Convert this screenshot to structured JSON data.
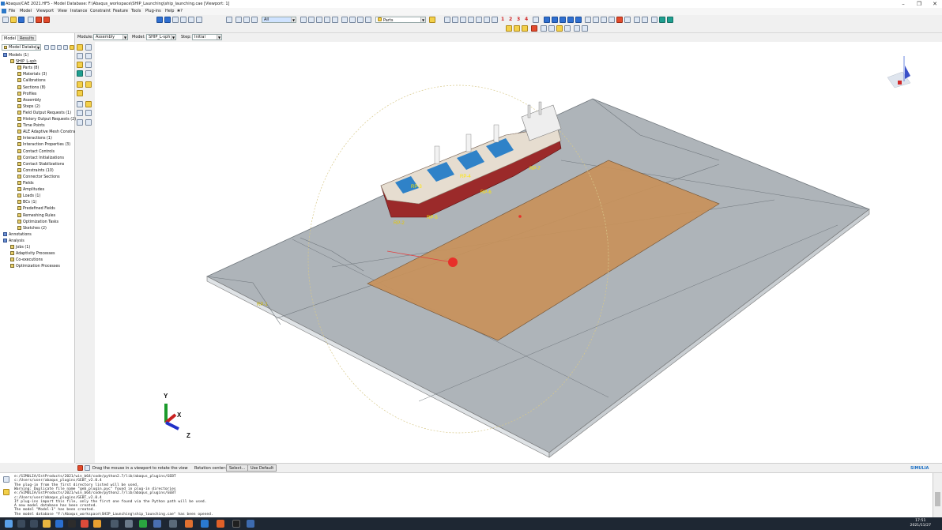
{
  "window": {
    "title": "Abaqus/CAE 2021.HF5 - Model Database: F:\\Abaqus_workspace\\SHIP_Launching\\ship_launching.cae [Viewport: 1]"
  },
  "menu": [
    "File",
    "Model",
    "Viewport",
    "View",
    "Instance",
    "Constraint",
    "Feature",
    "Tools",
    "Plug-ins",
    "Help",
    "❀?"
  ],
  "toolbar": {
    "filter_value": "All",
    "render_value": "Parts",
    "numbers": [
      "1",
      "2",
      "3",
      "4"
    ]
  },
  "left_panel": {
    "tabs": [
      "Model",
      "Results"
    ],
    "selector": "Model Database",
    "tree": [
      {
        "label": "Models (1)",
        "level": 0
      },
      {
        "label": "SHIP_L-sph",
        "level": 1
      },
      {
        "label": "Parts (8)",
        "level": 2
      },
      {
        "label": "Materials (3)",
        "level": 2
      },
      {
        "label": "Calibrations",
        "level": 2
      },
      {
        "label": "Sections (8)",
        "level": 2
      },
      {
        "label": "Profiles",
        "level": 2
      },
      {
        "label": "Assembly",
        "level": 2
      },
      {
        "label": "Steps (2)",
        "level": 2
      },
      {
        "label": "Field Output Requests (1)",
        "level": 2
      },
      {
        "label": "History Output Requests (2)",
        "level": 2
      },
      {
        "label": "Time Points",
        "level": 2
      },
      {
        "label": "ALE Adaptive Mesh Constra",
        "level": 2
      },
      {
        "label": "Interactions (1)",
        "level": 2
      },
      {
        "label": "Interaction Properties (3)",
        "level": 2
      },
      {
        "label": "Contact Controls",
        "level": 2
      },
      {
        "label": "Contact Initializations",
        "level": 2
      },
      {
        "label": "Contact Stabilizations",
        "level": 2
      },
      {
        "label": "Constraints (10)",
        "level": 2
      },
      {
        "label": "Connector Sections",
        "level": 2
      },
      {
        "label": "Fields",
        "level": 2
      },
      {
        "label": "Amplitudes",
        "level": 2
      },
      {
        "label": "Loads (1)",
        "level": 2
      },
      {
        "label": "BCs (1)",
        "level": 2
      },
      {
        "label": "Predefined Fields",
        "level": 2
      },
      {
        "label": "Remeshing Rules",
        "level": 2
      },
      {
        "label": "Optimization Tasks",
        "level": 2
      },
      {
        "label": "Sketches (2)",
        "level": 2
      },
      {
        "label": "Annotations",
        "level": 0
      },
      {
        "label": "Analysis",
        "level": 0
      },
      {
        "label": "Jobs (1)",
        "level": 1
      },
      {
        "label": "Adaptivity Processes",
        "level": 1
      },
      {
        "label": "Co-executions",
        "level": 1
      },
      {
        "label": "Optimization Processes",
        "level": 1
      }
    ]
  },
  "module_bar": {
    "module_label": "Module:",
    "module_value": "Assembly",
    "model_label": "Model:",
    "model_value": "SHIP_L-sph",
    "step_label": "Step:",
    "step_value": "Initial"
  },
  "viewport": {
    "ref_points": [
      "RP-1",
      "RP-2",
      "RP-3",
      "RP-4",
      "RP-5",
      "RP-6",
      "RP-7"
    ],
    "triad": {
      "x": "X",
      "y": "Y",
      "z": "Z"
    },
    "brand": "SIMULIA"
  },
  "statusbar": {
    "hint": "Drag the mouse in a viewport to rotate the view",
    "rotation_label": "Rotation center:",
    "select_btn": "Select...",
    "default_btn": "Use Default"
  },
  "messages": [
    "   e:/SIMULIA/EstProducts/2021/win_b64/code/python2.7/lib/abaqus_plugins/GEBT",
    "   c:/Users/user/abaqus_plugins/GEBT_v2.0.4",
    "   The plug-in from the first directory listed will be used.",
    "Warning: Duplicate file name \"geb_plugin.pyc\" found in plug-in directories",
    "   e:/SIMULIA/EstProducts/2021/win_b64/code/python2.7/lib/abaqus_plugins/GEBT",
    "   c:/Users/user/abaqus_plugins/GEBT_v2.0.4",
    "   If plug-ins import this file, only the first one found via the Python path will be used.",
    "A new model database has been created.",
    "The model \"Model-1\" has been created.",
    "The model database \"F:\\Abaqus_workspace\\SHIP_Launching\\ship_launching.cae\" has been opened."
  ],
  "taskbar": {
    "time": "17:51",
    "date": "2021/11/27"
  }
}
